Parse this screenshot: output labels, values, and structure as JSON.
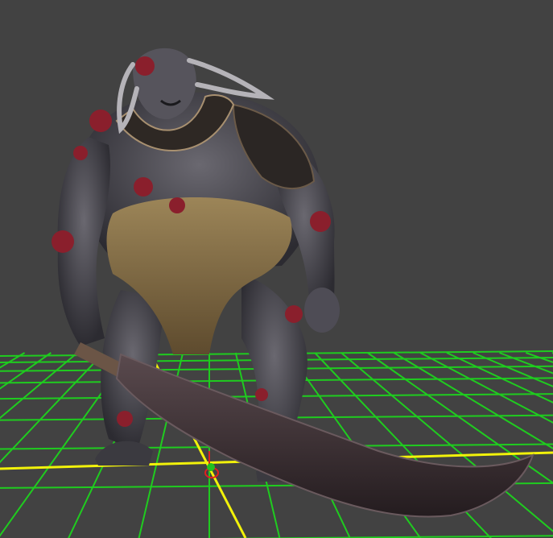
{
  "viewport": {
    "background_color": "#424242",
    "grid_color": "#1fcc1f",
    "axis_x_color": "#f2f20a",
    "axis_z_color": "#f2f20a",
    "gizmo_color": "#e02020",
    "gizmo_center_color": "#20c020"
  },
  "model": {
    "skin_color": "#4b4a52",
    "growth_color": "#8a1f2c",
    "cloth_color": "#8a7448",
    "blade_color": "#3e3336",
    "armor_color": "#2b2624"
  }
}
